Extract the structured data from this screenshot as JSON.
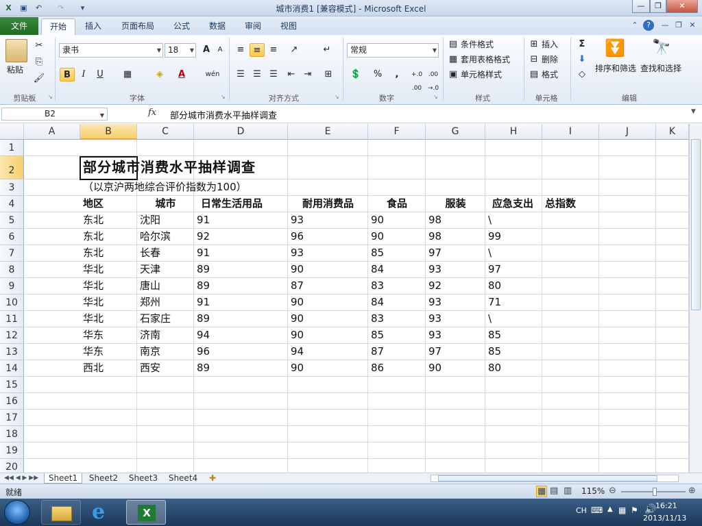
{
  "window": {
    "title": "城市消费1  [兼容模式] - Microsoft Excel",
    "min": "—",
    "max": "❐",
    "close": "✕"
  },
  "ribbon_tabs": [
    "开始",
    "插入",
    "页面布局",
    "公式",
    "数据",
    "审阅",
    "视图"
  ],
  "file_tab": "文件",
  "clipboard": {
    "paste": "粘贴",
    "label": "剪贴板"
  },
  "font": {
    "name": "隶书",
    "size": "18",
    "label": "字体",
    "bold": "B",
    "italic": "I",
    "underline": "U",
    "grow": "A",
    "shrink": "A",
    "color_glyph": "A",
    "fill_glyph": "◈",
    "wen": "wén"
  },
  "alignment": {
    "label": "对齐方式"
  },
  "number": {
    "format": "常规",
    "label": "数字",
    "percent": "%",
    "comma": ",",
    "inc_decimal": "+.0 .00",
    "dec_decimal": ".00 →.0"
  },
  "styles": {
    "cond": "条件格式",
    "table": "套用表格格式",
    "cell": "单元格样式",
    "label": "样式"
  },
  "cells": {
    "insert": "插入",
    "delete": "删除",
    "format": "格式",
    "label": "单元格"
  },
  "editing": {
    "sum": "Σ",
    "sort": "排序和筛选",
    "find": "查找和选择",
    "label": "编辑"
  },
  "formula_bar": {
    "name_box": "B2",
    "fx": "fx",
    "content": "部分城市消费水平抽样调查"
  },
  "columns": [
    "A",
    "B",
    "C",
    "D",
    "E",
    "F",
    "G",
    "H",
    "I",
    "J",
    "K"
  ],
  "rows": [
    "1",
    "2",
    "3",
    "4",
    "5",
    "6",
    "7",
    "8",
    "9",
    "10",
    "11",
    "12",
    "13",
    "14",
    "15",
    "16",
    "17",
    "18",
    "19",
    "20"
  ],
  "sheet": {
    "title": "部分城市消费水平抽样调查",
    "subtitle": "（以京沪两地综合评价指数为100）",
    "headers": [
      "地区",
      "城市",
      "日常生活用品",
      "耐用消费品",
      "食品",
      "服装",
      "应急支出",
      "总指数"
    ],
    "data": [
      [
        "东北",
        "沈阳",
        "91",
        "93",
        "90",
        "98",
        "\\"
      ],
      [
        "东北",
        "哈尔滨",
        "92",
        "96",
        "90",
        "98",
        "99"
      ],
      [
        "东北",
        "长春",
        "91",
        "93",
        "85",
        "97",
        "\\"
      ],
      [
        "华北",
        "天津",
        "89",
        "90",
        "84",
        "93",
        "97"
      ],
      [
        "华北",
        "唐山",
        "89",
        "87",
        "83",
        "92",
        "80"
      ],
      [
        "华北",
        "郑州",
        "91",
        "90",
        "84",
        "93",
        "71"
      ],
      [
        "华北",
        "石家庄",
        "89",
        "90",
        "83",
        "93",
        "\\"
      ],
      [
        "华东",
        "济南",
        "94",
        "90",
        "85",
        "93",
        "85"
      ],
      [
        "华东",
        "南京",
        "96",
        "94",
        "87",
        "97",
        "85"
      ],
      [
        "西北",
        "西安",
        "89",
        "90",
        "86",
        "90",
        "80"
      ]
    ]
  },
  "sheet_tabs": [
    "Sheet1",
    "Sheet2",
    "Sheet3",
    "Sheet4"
  ],
  "status": {
    "ready": "就绪",
    "zoom": "115%"
  },
  "taskbar": {
    "lang": "CH",
    "time": "16:21",
    "date": "2013/11/13"
  }
}
